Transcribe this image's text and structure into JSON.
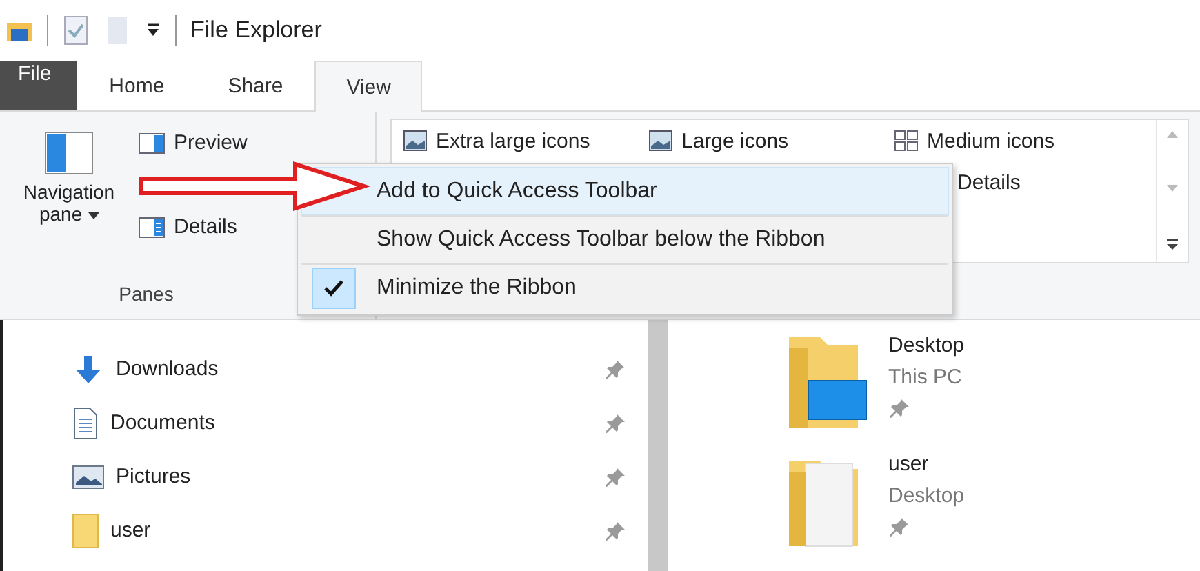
{
  "window": {
    "title": "File Explorer"
  },
  "tabs": [
    {
      "label": "File",
      "kind": "file",
      "selected": false
    },
    {
      "label": "Home",
      "kind": "tab",
      "selected": false
    },
    {
      "label": "Share",
      "kind": "tab",
      "selected": false
    },
    {
      "label": "View",
      "kind": "tab",
      "selected": true
    }
  ],
  "ribbon": {
    "navigation_pane": "Navigation pane",
    "pane_buttons": [
      {
        "label": "Preview",
        "kind": "preview"
      },
      {
        "label": "Details",
        "kind": "details"
      }
    ],
    "group_label": "Panes",
    "layouts": [
      {
        "label": "Extra large icons",
        "kind": "photo"
      },
      {
        "label": "Large icons",
        "kind": "photo"
      },
      {
        "label": "Medium icons",
        "kind": "grid"
      },
      {
        "label": "Details",
        "kind": "none"
      }
    ]
  },
  "context_menu": [
    {
      "label": "Add to Quick Access Toolbar",
      "highlighted": true,
      "checked": false
    },
    {
      "label": "Show Quick Access Toolbar below the Ribbon",
      "highlighted": false,
      "checked": false
    },
    {
      "label": "Minimize the Ribbon",
      "highlighted": false,
      "checked": true
    }
  ],
  "quick_access": [
    {
      "label": "Downloads",
      "kind": "download",
      "pinned": true
    },
    {
      "label": "Documents",
      "kind": "document",
      "pinned": true
    },
    {
      "label": "Pictures",
      "kind": "picture",
      "pinned": true
    },
    {
      "label": "user",
      "kind": "folder",
      "pinned": true
    }
  ],
  "files": [
    {
      "name": "Desktop",
      "location": "This PC",
      "kind": "desktop",
      "pinned": true
    },
    {
      "name": "user",
      "location": "Desktop",
      "kind": "folder",
      "pinned": true
    }
  ]
}
